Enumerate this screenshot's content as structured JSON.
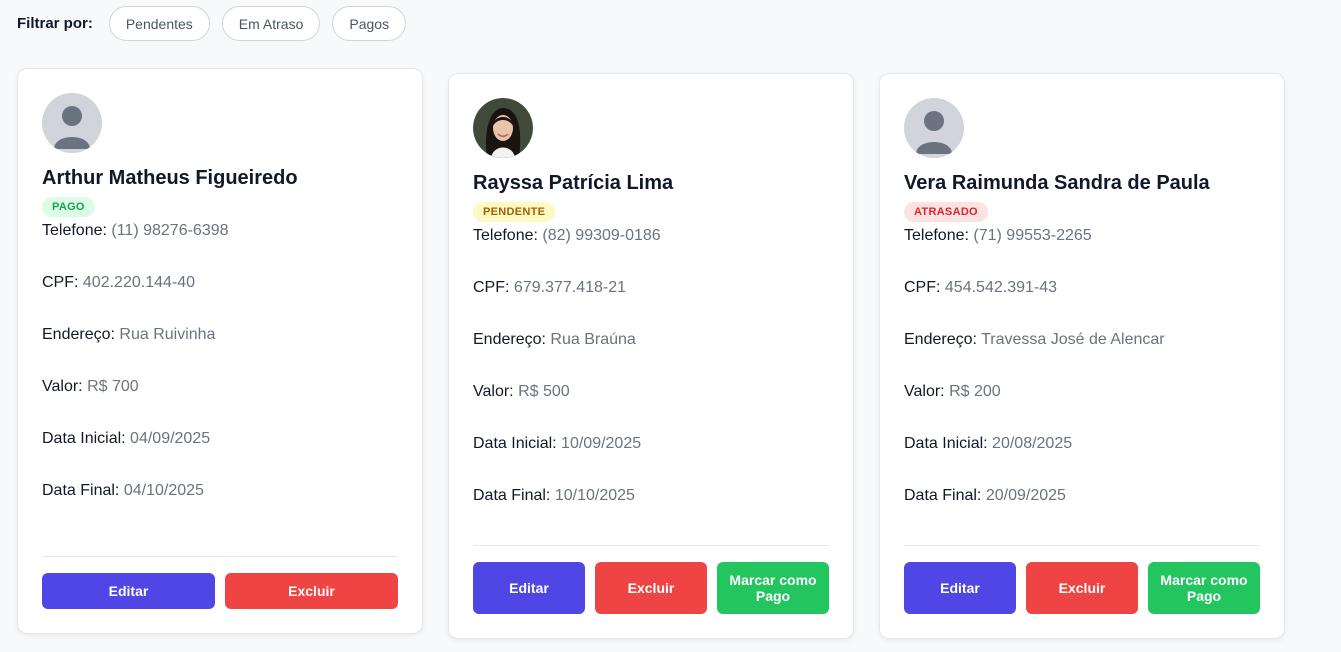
{
  "filter": {
    "label": "Filtrar por:",
    "options": [
      "Pendentes",
      "Em Atraso",
      "Pagos"
    ]
  },
  "labels": {
    "phone": "Telefone:",
    "cpf": "CPF:",
    "address": "Endereço:",
    "value": "Valor:",
    "start": "Data Inicial:",
    "end": "Data Final:"
  },
  "buttons": {
    "edit": "Editar",
    "delete": "Excluir",
    "mark_paid": "Marcar como\nPago"
  },
  "clients": [
    {
      "name": "Arthur Matheus Figueiredo",
      "status": "PAGO",
      "phone": "(11) 98276-6398",
      "cpf": "402.220.144-40",
      "address": "Rua Ruivinha",
      "value": "R$ 700",
      "start": "04/09/2025",
      "end": "04/10/2025"
    },
    {
      "name": "Rayssa Patrícia Lima",
      "status": "PENDENTE",
      "phone": "(82) 99309-0186",
      "cpf": "679.377.418-21",
      "address": "Rua Braúna",
      "value": "R$ 500",
      "start": "10/09/2025",
      "end": "10/10/2025"
    },
    {
      "name": "Vera Raimunda Sandra de Paula",
      "status": "ATRASADO",
      "phone": "(71) 99553-2265",
      "cpf": "454.542.391-43",
      "address": "Travessa José de Alencar",
      "value": "R$ 200",
      "start": "20/08/2025",
      "end": "20/09/2025"
    }
  ],
  "colors": {
    "edit": "#4f46e5",
    "delete": "#ef4444",
    "paid": "#22c55e",
    "badge_pago": "#16a34a",
    "badge_pendente": "#a16207",
    "badge_atrasado": "#dc2626"
  },
  "icons": {
    "default_avatar": "user-silhouette-icon",
    "photo_avatar": "user-photo"
  }
}
